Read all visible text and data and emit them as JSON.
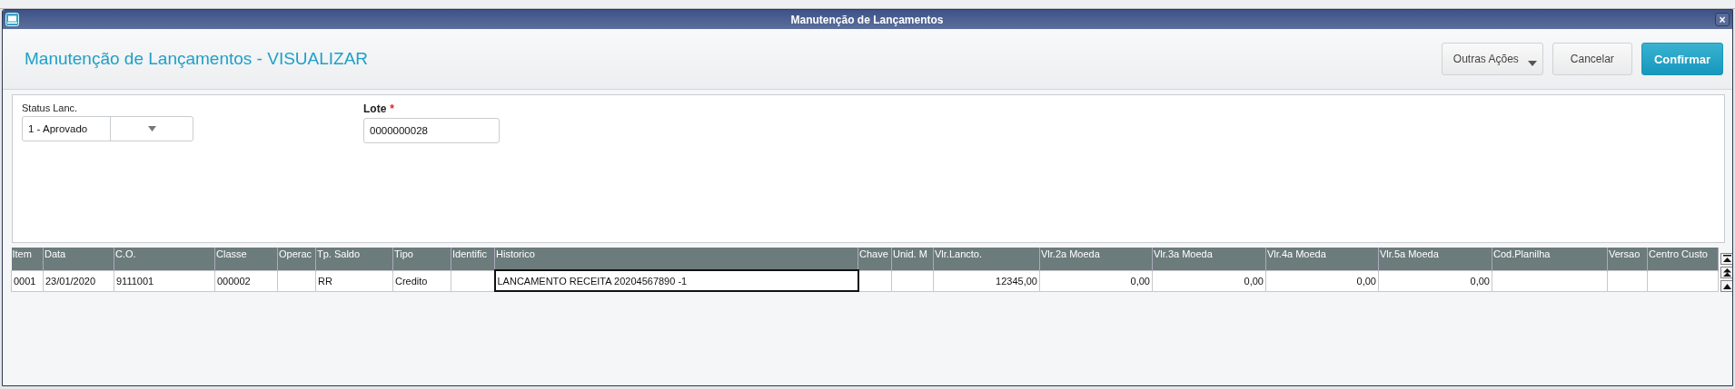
{
  "window": {
    "title": "Manutenção de Lançamentos",
    "close": "×"
  },
  "header": {
    "title": "Manutenção de Lançamentos - VISUALIZAR",
    "buttons": [
      {
        "label": "Outras Ações",
        "kind": "menu"
      },
      {
        "label": "Cancelar",
        "kind": "plain"
      },
      {
        "label": "Confirmar",
        "kind": "primary"
      }
    ]
  },
  "form": {
    "fields": [
      {
        "label": "Status Lanc.",
        "value": "1 - Aprovado",
        "kind": "select"
      },
      {
        "label": "Lote",
        "required_mark": "*",
        "value": "0000000028",
        "kind": "text"
      }
    ]
  },
  "table": {
    "columns": [
      {
        "label": "Item",
        "kind": "text"
      },
      {
        "label": "Data",
        "kind": "text"
      },
      {
        "label": "C.O.",
        "kind": "text"
      },
      {
        "label": "Classe",
        "kind": "text"
      },
      {
        "label": "Operac",
        "kind": "text"
      },
      {
        "label": "Tp. Saldo",
        "kind": "text"
      },
      {
        "label": "Tipo",
        "kind": "text"
      },
      {
        "label": "Identific",
        "kind": "text"
      },
      {
        "label": "Historico",
        "kind": "text"
      },
      {
        "label": "Chave",
        "kind": "text"
      },
      {
        "label": "Unid. M",
        "kind": "text"
      },
      {
        "label": "Vlr.Lancto.",
        "kind": "number"
      },
      {
        "label": "Vlr.2a Moeda",
        "kind": "number"
      },
      {
        "label": "Vlr.3a Moeda",
        "kind": "number"
      },
      {
        "label": "Vlr.4a Moeda",
        "kind": "number"
      },
      {
        "label": "Vlr.5a Moeda",
        "kind": "number"
      },
      {
        "label": "Cod.Planilha",
        "kind": "text"
      },
      {
        "label": "Versao",
        "kind": "text"
      },
      {
        "label": "Centro Custo",
        "kind": "text"
      }
    ],
    "rows": [
      {
        "cells": [
          {
            "text": "0001",
            "focused": false
          },
          {
            "text": "23/01/2020",
            "focused": false
          },
          {
            "text": "9111001",
            "focused": false
          },
          {
            "text": "000002",
            "focused": false
          },
          {
            "focused": false
          },
          {
            "text": "RR",
            "focused": false
          },
          {
            "text": "Credito",
            "focused": false
          },
          {
            "focused": false
          },
          {
            "text": "LANCAMENTO RECEITA 20204567890  -1",
            "focused": true
          },
          {
            "focused": false
          },
          {
            "focused": false
          },
          {
            "text": "12345,00",
            "focused": false
          },
          {
            "text": "0,00",
            "focused": false
          },
          {
            "text": "0,00",
            "focused": false
          },
          {
            "text": "0,00",
            "focused": false
          },
          {
            "text": "0,00",
            "focused": false
          },
          {
            "focused": false
          },
          {
            "focused": false
          },
          {
            "focused": false
          }
        ]
      }
    ]
  }
}
